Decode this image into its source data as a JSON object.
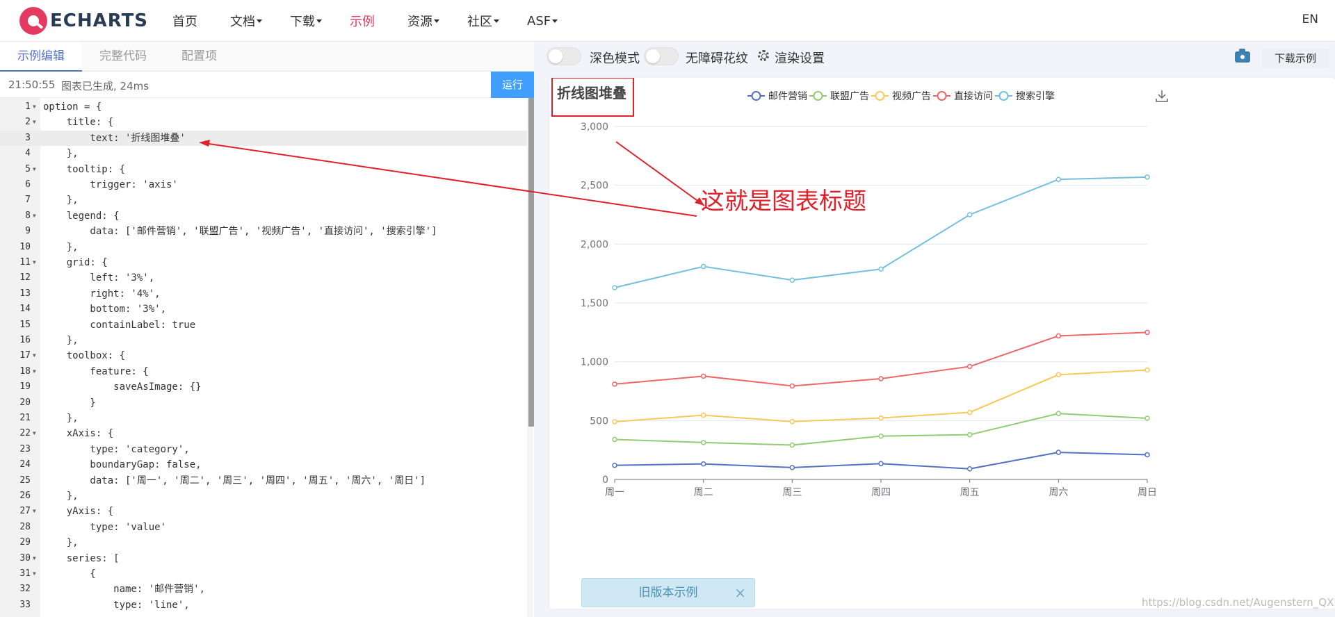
{
  "nav": {
    "logo_text": "ECHARTS",
    "items": [
      {
        "label": "首页",
        "dropdown": false,
        "active": false
      },
      {
        "label": "文档",
        "dropdown": true,
        "active": false
      },
      {
        "label": "下载",
        "dropdown": true,
        "active": false
      },
      {
        "label": "示例",
        "dropdown": false,
        "active": true
      },
      {
        "label": "资源",
        "dropdown": true,
        "active": false
      },
      {
        "label": "社区",
        "dropdown": true,
        "active": false
      },
      {
        "label": "ASF",
        "dropdown": true,
        "active": false
      }
    ],
    "lang": "EN",
    "accent": "#e43961"
  },
  "editor": {
    "tabs": [
      "示例编辑",
      "完整代码",
      "配置项"
    ],
    "active_tab": "示例编辑",
    "status_time": "21:50:55",
    "status_msg": "图表已生成, 24ms",
    "run_label": "运行",
    "highlight_line": 3,
    "lines": [
      "option = {",
      "    title: {",
      "        text: '折线图堆叠'",
      "    },",
      "    tooltip: {",
      "        trigger: 'axis'",
      "    },",
      "    legend: {",
      "        data: ['邮件营销', '联盟广告', '视频广告', '直接访问', '搜索引擎']",
      "    },",
      "    grid: {",
      "        left: '3%',",
      "        right: '4%',",
      "        bottom: '3%',",
      "        containLabel: true",
      "    },",
      "    toolbox: {",
      "        feature: {",
      "            saveAsImage: {}",
      "        }",
      "    },",
      "    xAxis: {",
      "        type: 'category',",
      "        boundaryGap: false,",
      "        data: ['周一', '周二', '周三', '周四', '周五', '周六', '周日']",
      "    },",
      "    yAxis: {",
      "        type: 'value'",
      "    },",
      "    series: [",
      "        {",
      "            name: '邮件营销',",
      "            type: 'line',"
    ],
    "fold_lines": [
      1,
      2,
      5,
      8,
      11,
      17,
      18,
      22,
      27,
      30,
      31
    ]
  },
  "preview": {
    "dark_mode_label": "深色模式",
    "aria_label": "无障碍花纹",
    "render_settings_label": "渲染设置",
    "download_label": "下载示例"
  },
  "annotation": {
    "text": "这就是图表标题",
    "color": "#e0202a"
  },
  "old_version": {
    "label": "旧版本示例",
    "close": "×"
  },
  "watermark": "https://blog.csdn.net/Augenstern_QXL",
  "chart_data": {
    "type": "line",
    "title": "折线图堆叠",
    "categories": [
      "周一",
      "周二",
      "周三",
      "周四",
      "周五",
      "周六",
      "周日"
    ],
    "ylim": [
      0,
      3000
    ],
    "yticks": [
      "0",
      "500",
      "1,000",
      "1,500",
      "2,000",
      "2,500",
      "3,000"
    ],
    "stacked": true,
    "legend_position": "top",
    "grid": true,
    "series": [
      {
        "name": "邮件营销",
        "color": "#5470c6",
        "values": [
          120,
          132,
          101,
          134,
          90,
          230,
          210
        ]
      },
      {
        "name": "联盟广告",
        "color": "#91cc75",
        "values": [
          340,
          314,
          292,
          368,
          380,
          560,
          520
        ]
      },
      {
        "name": "视频广告",
        "color": "#fac858",
        "values": [
          490,
          546,
          492,
          522,
          570,
          890,
          930
        ]
      },
      {
        "name": "直接访问",
        "color": "#ee6666",
        "values": [
          810,
          878,
          794,
          856,
          960,
          1220,
          1250
        ]
      },
      {
        "name": "搜索引擎",
        "color": "#73c0de",
        "values": [
          1630,
          1810,
          1694,
          1788,
          2250,
          2550,
          2570
        ]
      }
    ]
  }
}
